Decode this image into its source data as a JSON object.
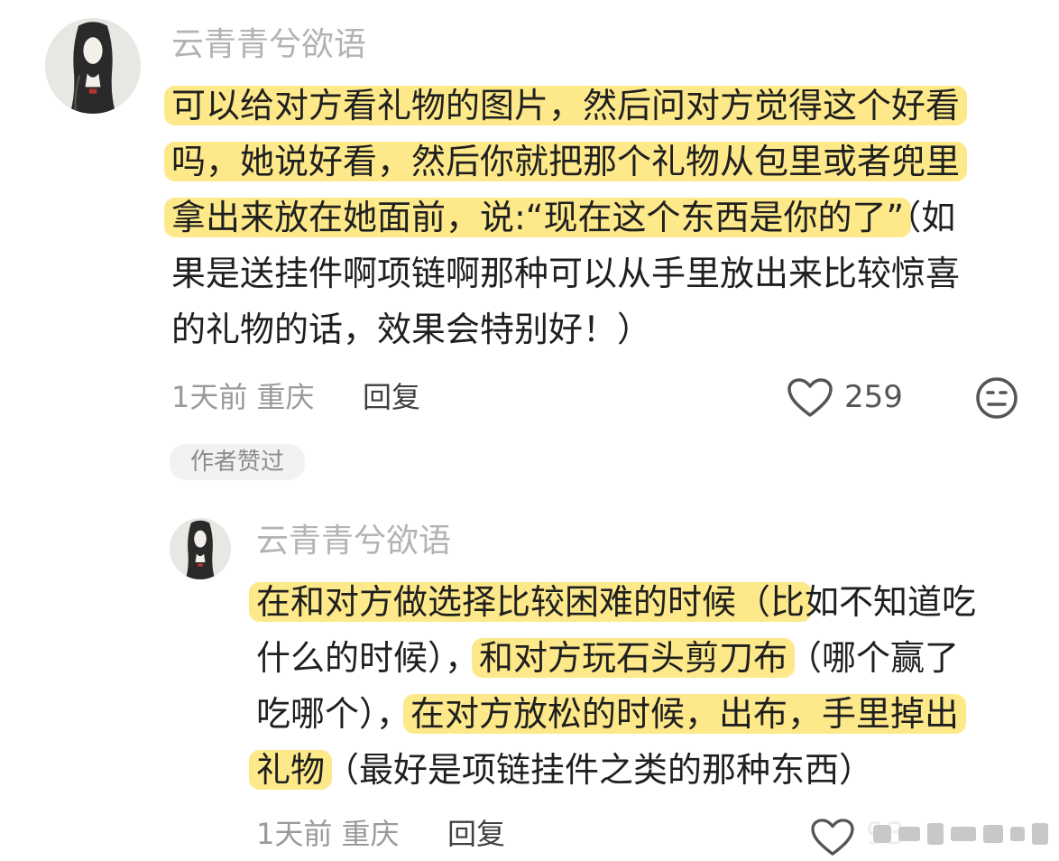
{
  "comment": {
    "username": "云青青兮欲语",
    "lines": [
      [
        {
          "t": "可以给对方看礼物的图片，然后问对方觉得这个好看",
          "hl": true
        }
      ],
      [
        {
          "t": "吗，她说好看，然后你就把那个礼物从包里或者兜里",
          "hl": true
        }
      ],
      [
        {
          "t": "拿出来放在她面前，说:“现在这个东西是你的了”",
          "hl": true
        },
        {
          "t": "（如",
          "hl": false
        }
      ],
      [
        {
          "t": "果是送挂件啊项链啊那种可以从手里放出来比较惊喜",
          "hl": false
        }
      ],
      [
        {
          "t": "的礼物的话，效果会特别好！）",
          "hl": false
        }
      ]
    ],
    "meta": "1天前 重庆",
    "reply_label": "回复",
    "like_count": "259",
    "badge": "作者赞过"
  },
  "reply": {
    "username": "云青青兮欲语",
    "lines": [
      [
        {
          "t": "在和对方做选择比较困难的时候（比",
          "hl": true
        },
        {
          "t": "如不知道吃",
          "hl": false
        }
      ],
      [
        {
          "t": "什么的时候），",
          "hl": false
        },
        {
          "t": "和对方玩石头剪刀布",
          "hl": true
        },
        {
          "t": "（哪个赢了",
          "hl": false
        }
      ],
      [
        {
          "t": "吃哪个），",
          "hl": false
        },
        {
          "t": "在对方放松的时候，出布，手里掉出",
          "hl": true
        }
      ],
      [
        {
          "t": "礼物",
          "hl": true
        },
        {
          "t": "（最好是项链挂件之类的那种东西）",
          "hl": false
        }
      ]
    ],
    "meta": "1天前 重庆",
    "reply_label": "回复",
    "like_count": "93"
  },
  "colors": {
    "highlight": "#fde98a",
    "username": "#b3b3b3",
    "text": "#1f1f1f",
    "meta": "#9a9a9a"
  },
  "icons": [
    "heart-icon",
    "dislike-face-icon",
    "watermark"
  ]
}
